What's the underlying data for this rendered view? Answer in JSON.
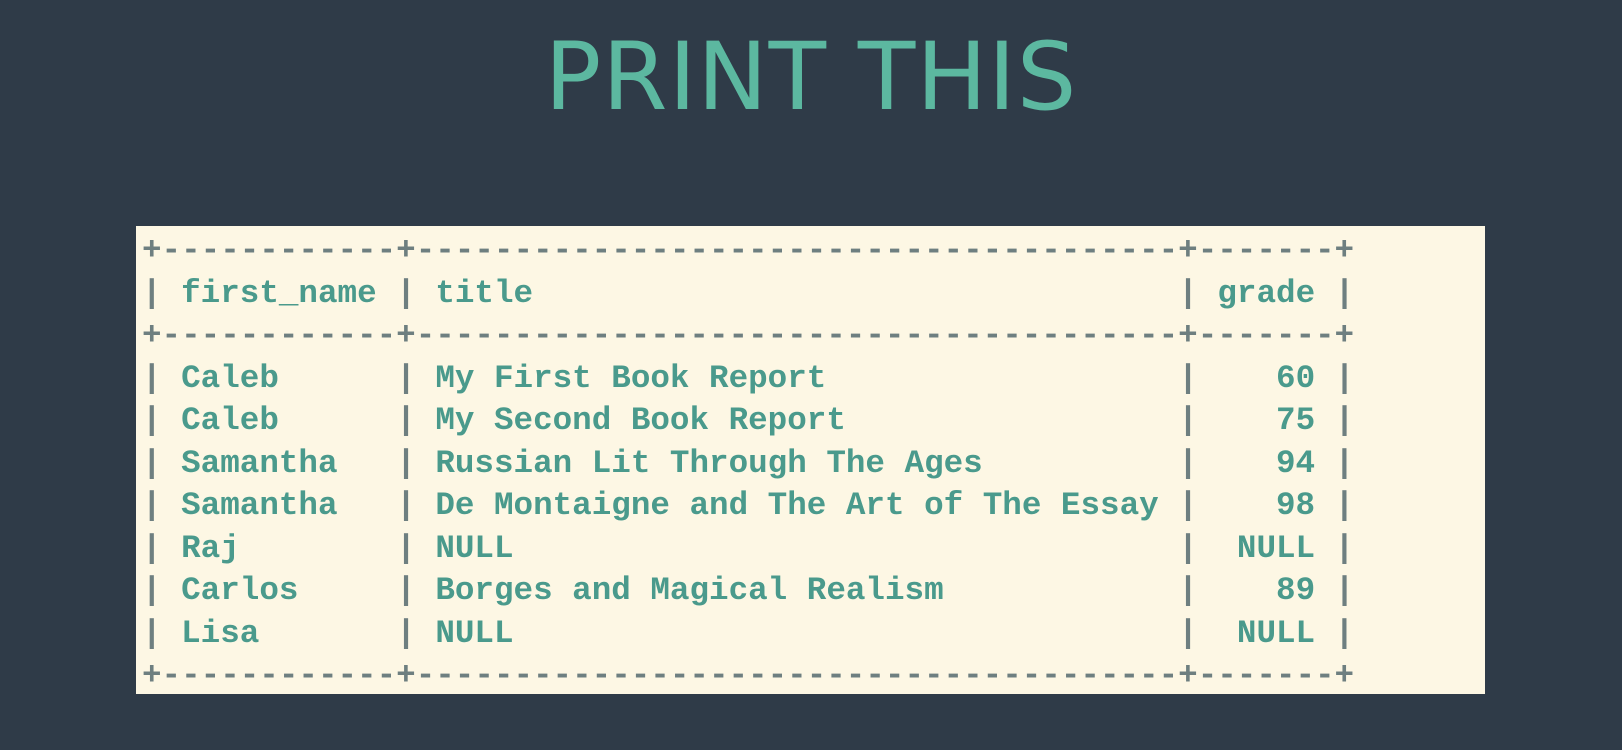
{
  "slide": {
    "title": "PRINT THIS"
  },
  "table": {
    "headers": [
      "first_name",
      "title",
      "grade"
    ],
    "rows": [
      [
        "Caleb",
        "My First Book Report",
        "60"
      ],
      [
        "Caleb",
        "My Second Book Report",
        "75"
      ],
      [
        "Samantha",
        "Russian Lit Through The Ages",
        "94"
      ],
      [
        "Samantha",
        "De Montaigne and The Art of The Essay",
        "98"
      ],
      [
        "Raj",
        "NULL",
        "NULL"
      ],
      [
        "Carlos",
        "Borges and Magical Realism",
        "89"
      ],
      [
        "Lisa",
        "NULL",
        "NULL"
      ]
    ]
  },
  "colors": {
    "background": "#2f3b48",
    "accent": "#5cb8a0",
    "panel": "#fdf7e4",
    "text": "#4a9a8c",
    "frame": "#6e7f80"
  }
}
